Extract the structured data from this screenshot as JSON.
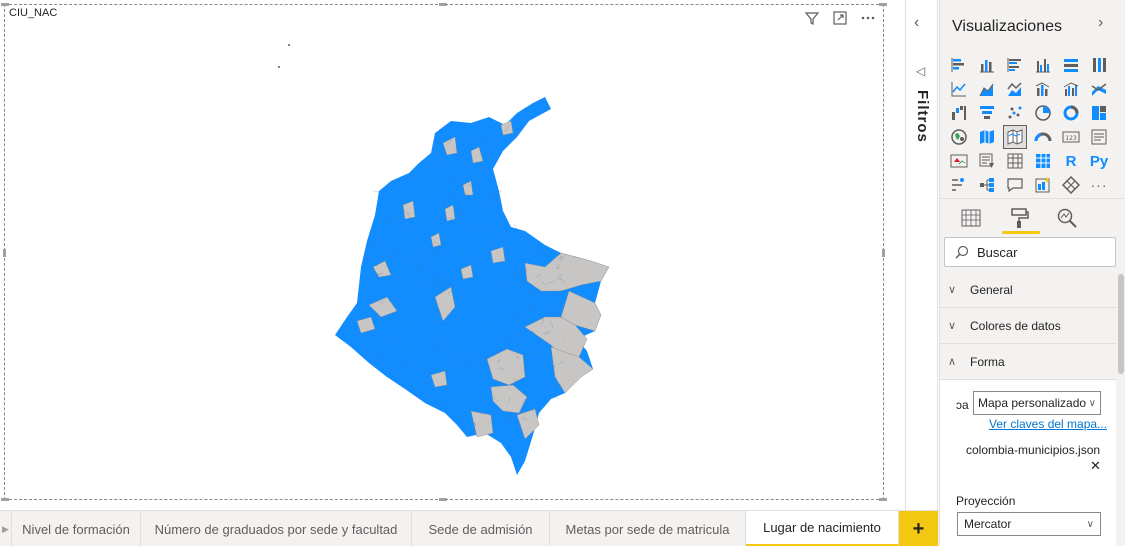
{
  "visual": {
    "title": "CIU_NAC",
    "toolbar": [
      {
        "name": "filter-icon",
        "glyph": "⊽"
      },
      {
        "name": "focus-mode-icon",
        "glyph": "⤢"
      },
      {
        "name": "more-options-icon",
        "glyph": "⋯"
      }
    ],
    "map_fill_color": "#118dff",
    "map_unmatched_color": "#c8c6c4"
  },
  "filters": {
    "label": "Filtros",
    "collapse_glyph": "‹",
    "icon_glyph": "◁"
  },
  "visualizations": {
    "title": "Visualizaciones",
    "expand_glyph": "›",
    "text_icons": {
      "r": "R",
      "py": "Py",
      "more": "···"
    }
  },
  "search": {
    "placeholder": "Buscar"
  },
  "format_sections": {
    "general": "General",
    "data_colors": "Colores de datos",
    "shape": "Forma"
  },
  "shape": {
    "prefix": "ɔa",
    "map_type": "Mapa personalizado",
    "map_keys_link": "Ver claves del mapa...",
    "json_file": "colombia-municipios.json",
    "remove_glyph": "✕",
    "projection_label": "Proyección",
    "projection_value": "Mercator"
  },
  "page_tabs": [
    {
      "label": "Nivel de formación",
      "active": false
    },
    {
      "label": "Número de graduados por sede y facultad",
      "active": false
    },
    {
      "label": "Sede de admisión",
      "active": false
    },
    {
      "label": "Metas por sede de matricula",
      "active": false
    },
    {
      "label": "Lugar de nacimiento",
      "active": true
    }
  ],
  "add_page_glyph": "+",
  "accent_color": "#f2c811"
}
